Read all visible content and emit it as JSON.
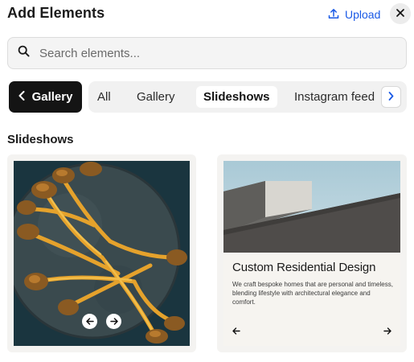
{
  "header": {
    "title": "Add Elements",
    "upload_label": "Upload"
  },
  "search": {
    "placeholder": "Search elements..."
  },
  "filters": {
    "back_label": "Gallery",
    "tabs": [
      {
        "label": "All",
        "active": false
      },
      {
        "label": "Gallery",
        "active": false
      },
      {
        "label": "Slideshows",
        "active": true
      },
      {
        "label": "Instagram feed",
        "active": false
      }
    ]
  },
  "section": {
    "title": "Slideshows"
  },
  "cards": [
    {
      "kind": "photo-slideshow"
    },
    {
      "kind": "text-slideshow",
      "heading": "Custom Residential Design",
      "body": "We craft bespoke homes that are personal and timeless, blending lifestyle with architectural elegance and comfort."
    }
  ],
  "colors": {
    "accent": "#1a5ae6",
    "dark_pill": "#141414",
    "card_bg": "#f4f3f1"
  },
  "icons": [
    "upload-icon",
    "close-icon",
    "search-icon",
    "chevron-left-icon",
    "chevron-right-icon",
    "arrow-left-icon",
    "arrow-right-icon"
  ]
}
